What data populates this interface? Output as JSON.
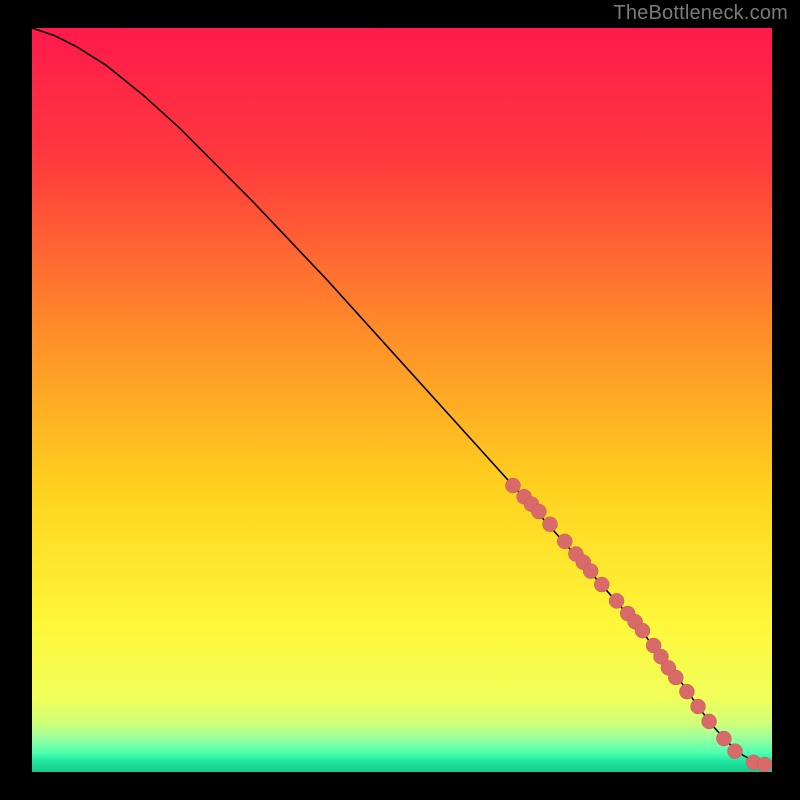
{
  "attribution": "TheBottleneck.com",
  "colors": {
    "gradient_stops": [
      {
        "offset": 0.0,
        "color": "#ff1a4b"
      },
      {
        "offset": 0.18,
        "color": "#ff3a3d"
      },
      {
        "offset": 0.4,
        "color": "#ff8a2a"
      },
      {
        "offset": 0.62,
        "color": "#ffd21f"
      },
      {
        "offset": 0.8,
        "color": "#fff73a"
      },
      {
        "offset": 0.9,
        "color": "#f1ff5a"
      },
      {
        "offset": 0.935,
        "color": "#ceff7a"
      },
      {
        "offset": 0.955,
        "color": "#98ffa0"
      },
      {
        "offset": 0.975,
        "color": "#4bffb0"
      },
      {
        "offset": 0.985,
        "color": "#20e8a0"
      },
      {
        "offset": 1.0,
        "color": "#18c98c"
      }
    ],
    "curve": "#000000",
    "marker_fill": "#d86a6a",
    "marker_stroke": "#c95a5a",
    "frame": "#000000"
  },
  "chart_data": {
    "type": "line",
    "title": "",
    "xlabel": "",
    "ylabel": "",
    "xlim": [
      0,
      100
    ],
    "ylim": [
      0,
      100
    ],
    "series": [
      {
        "name": "bottleneck-curve",
        "x": [
          0,
          3,
          6,
          10,
          15,
          20,
          30,
          40,
          50,
          60,
          70,
          78,
          82,
          85,
          88,
          90,
          92,
          94,
          96,
          98,
          100
        ],
        "y": [
          100,
          99,
          97.5,
          95,
          91,
          86.5,
          76.5,
          66,
          55,
          44,
          33,
          24,
          19.5,
          15.5,
          11.7,
          8.8,
          6.2,
          4,
          2.3,
          1.2,
          1.0
        ]
      }
    ],
    "markers": {
      "name": "highlighted-points",
      "x": [
        65,
        66.5,
        67.5,
        68.5,
        70,
        72,
        73.5,
        74.5,
        75.5,
        77,
        79,
        80.5,
        81.5,
        82.5,
        84,
        85,
        86,
        87,
        88.5,
        90,
        91.5,
        93.5,
        95,
        97.5,
        99
      ],
      "y": [
        38.5,
        37,
        36,
        35,
        33.3,
        31,
        29.3,
        28.2,
        27,
        25.2,
        23,
        21.3,
        20.2,
        19,
        17,
        15.5,
        14,
        12.7,
        10.8,
        8.8,
        6.8,
        4.5,
        2.8,
        1.3,
        1.0
      ]
    }
  }
}
